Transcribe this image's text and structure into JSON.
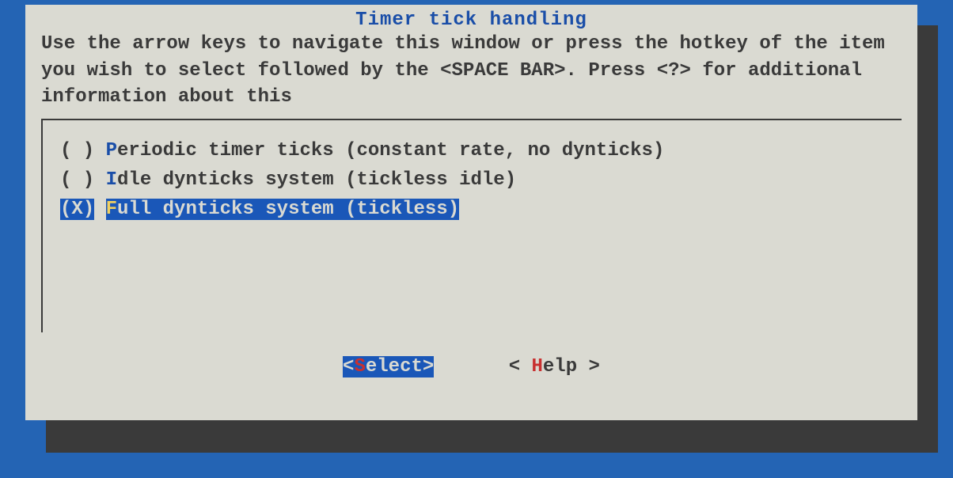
{
  "title": "Timer tick handling",
  "instructions": "Use the arrow keys to navigate this window or press the hotkey of the item you wish to select followed by the <SPACE BAR>. Press <?> for additional information about this",
  "options": [
    {
      "marker": "( )",
      "hotkey": "P",
      "rest": "eriodic timer ticks (constant rate, no dynticks)",
      "selected": false
    },
    {
      "marker": "( )",
      "hotkey": "I",
      "rest": "dle dynticks system (tickless idle)",
      "selected": false
    },
    {
      "marker": "(X)",
      "hotkey": "F",
      "rest": "ull dynticks system (tickless)",
      "selected": true
    }
  ],
  "buttons": {
    "select": {
      "open": "<",
      "hot": "S",
      "rest": "elect",
      "close": ">"
    },
    "help": {
      "open": "< ",
      "hot": "H",
      "rest": "elp",
      "close": " >"
    }
  }
}
